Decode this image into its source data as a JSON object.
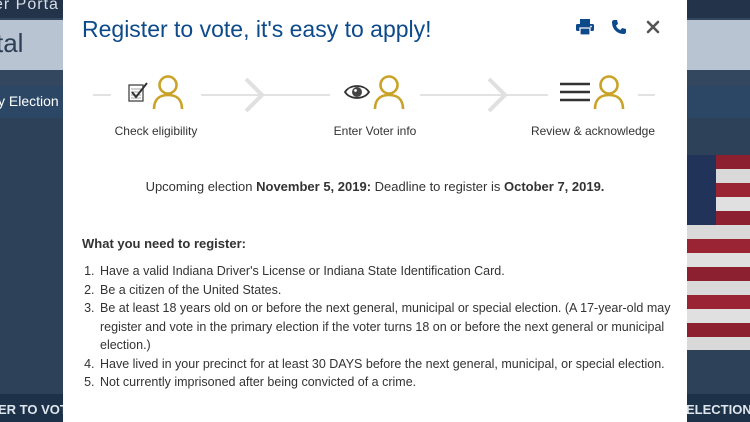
{
  "background": {
    "portal_text": "er Porta",
    "title_text": "tal",
    "nav_text": "y Election",
    "bottom_left": "ER TO VOTE",
    "bottom_right": "ELECTION"
  },
  "modal": {
    "title": "Register to vote, it's easy to apply!",
    "tools": [
      "printer-icon",
      "phone-icon",
      "close-icon"
    ],
    "steps": [
      {
        "label": "Check eligibility",
        "icon": "checklist-icon"
      },
      {
        "label": "Enter Voter info",
        "icon": "eye-icon"
      },
      {
        "label": "Review & acknowledge",
        "icon": "menu-lines-icon"
      }
    ],
    "election": {
      "prefix": "Upcoming election ",
      "date": "November 5, 2019:",
      "middle": " Deadline to register is ",
      "deadline": "October 7, 2019."
    },
    "need_heading": "What you need to register:",
    "requirements": [
      "Have a valid Indiana Driver's License or Indiana State Identification Card.",
      "Be a citizen of the United States.",
      "Be at least 18 years old on or before the next general, municipal or special election. (A 17-year-old may register and vote in the primary election if the voter turns 18 on or before the next general or municipal election.)",
      "Have lived in your precinct for at least 30 DAYS before the next general, municipal, or special election.",
      "Not currently imprisoned after being convicted of a crime."
    ]
  },
  "colors": {
    "title_blue": "#0d4a8a",
    "person_gold": "#c9a227",
    "overlay": "#33485f"
  }
}
